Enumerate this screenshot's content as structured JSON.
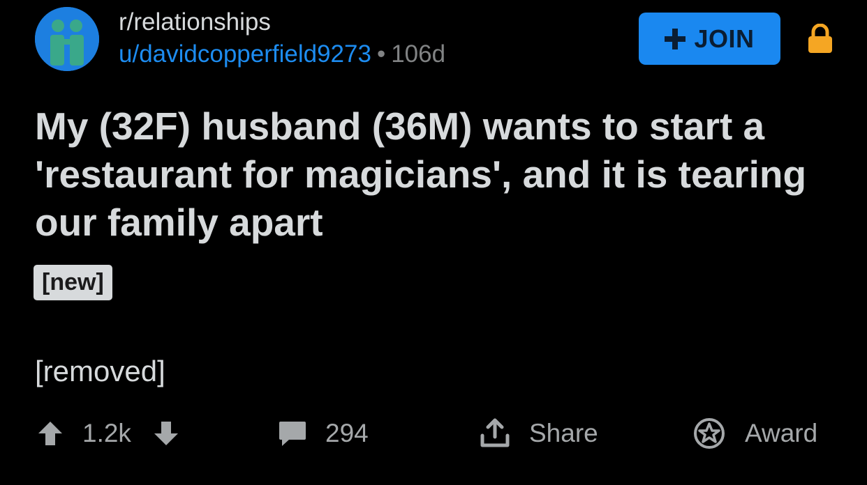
{
  "post": {
    "subreddit": "r/relationships",
    "author": "u/davidcopperfield9273",
    "separator": "•",
    "age": "106d",
    "title": "My (32F) husband (36M) wants to start a 'restaurant for magicians', and it is tearing our family apart",
    "flair": "[new]",
    "body": "[removed]"
  },
  "header": {
    "join_label": "JOIN"
  },
  "actions": {
    "upvotes": "1.2k",
    "comments": "294",
    "share_label": "Share",
    "award_label": "Award"
  },
  "icons": {
    "avatar": "subreddit-avatar-two-people",
    "join": "plus-icon",
    "lock": "lock-icon",
    "upvote": "arrow-up-icon",
    "downvote": "arrow-down-icon",
    "comment": "comment-bubble-icon",
    "share": "share-icon",
    "award": "award-icon"
  },
  "colors": {
    "background": "#000000",
    "text": "#d7dadc",
    "username": "#1d8cf0",
    "join_button": "#1a88f0",
    "lock": "#f5a623",
    "muted": "#818384"
  }
}
